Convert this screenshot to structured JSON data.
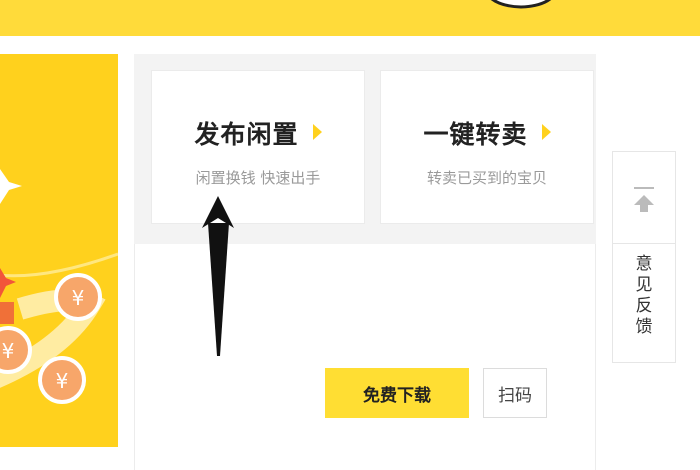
{
  "colors": {
    "accent": "#ffdb3a",
    "banner": "#ffd11d",
    "coin": "#f7a66a"
  },
  "header": {
    "mascot_icon": "mascot-face-icon"
  },
  "cards": [
    {
      "title": "发布闲置",
      "subtitle": "闲置换钱 快速出手",
      "icon": "chevron-right-icon"
    },
    {
      "title": "一键转卖",
      "subtitle": "转卖已买到的宝贝",
      "icon": "chevron-right-icon"
    }
  ],
  "actions": {
    "download_label": "免费下载",
    "scan_label": "扫码"
  },
  "sidebar": {
    "back_to_top_icon": "back-to-top-icon",
    "feedback_chars": [
      "意",
      "见",
      "反",
      "馈"
    ]
  },
  "annotation": {
    "icon": "pointer-arrow-icon"
  }
}
